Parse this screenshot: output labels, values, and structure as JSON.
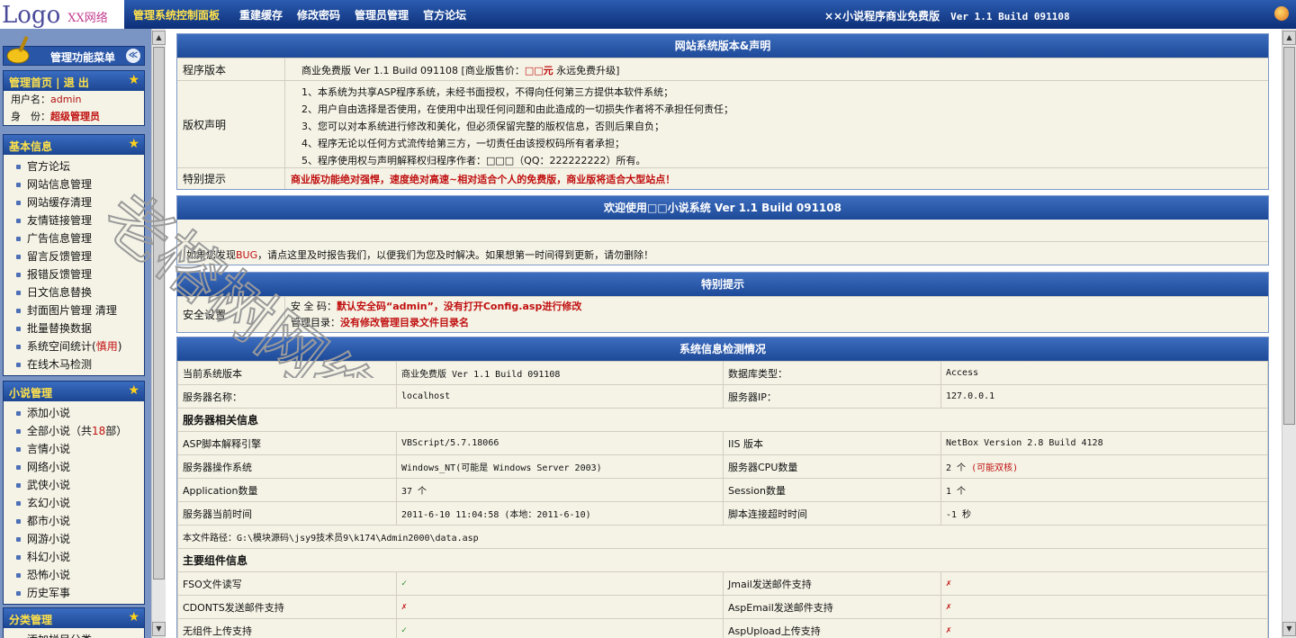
{
  "logo": {
    "main": "Logo",
    "sub": "XX网络"
  },
  "topnav": {
    "items": [
      "管理系统控制面板",
      "重建缓存",
      "修改密码",
      "管理员管理",
      "官方论坛"
    ],
    "right_title": "××小说程序商业免费版",
    "right_version": "Ver 1.1 Build 091108"
  },
  "sidebar": {
    "header": "管理功能菜单",
    "home_box": {
      "title": "管理首页 | 退 出",
      "user_label": "用户名：",
      "user_value": "admin",
      "role_label": "身　份：",
      "role_value": "超级管理员"
    },
    "basic": {
      "title": "基本信息",
      "items": [
        "官方论坛",
        "网站信息管理",
        "网站缓存清理",
        "友情链接管理",
        "广告信息管理",
        "留言反馈管理",
        "报错反馈管理",
        "日文信息替换",
        "封面图片管理 清理",
        "批量替换数据",
        "系统空间统计(",
        "在线木马检测"
      ],
      "items_extra": "慎用",
      "items_extra_close": ")"
    },
    "novel": {
      "title": "小说管理",
      "items": [
        "添加小说",
        "全部小说（共",
        "言情小说",
        "网络小说",
        "武侠小说",
        "玄幻小说",
        "都市小说",
        "网游小说",
        "科幻小说",
        "恐怖小说",
        "历史军事"
      ],
      "count": "18",
      "count_suffix": "部）"
    },
    "category": {
      "title": "分类管理",
      "items": [
        "添加栏目分类"
      ]
    }
  },
  "panel1": {
    "title": "网站系统版本&声明",
    "version_label": "程序版本",
    "version_prefix": "商业免费版  Ver 1.1 Build 091108 [商业版售价：",
    "version_price": "□□元",
    "version_suffix": " 永远免费升级]",
    "copyright_label": "版权声明",
    "copyright_lines": [
      "1、本系统为共享ASP程序系统，未经书面授权，不得向任何第三方提供本软件系统；",
      "2、用户自由选择是否使用，在使用中出现任何问题和由此造成的一切损失作者将不承担任何责任；",
      "3、您可以对本系统进行修改和美化，但必须保留完整的版权信息，否则后果自负；",
      "4、程序无论以任何方式流传给第三方，一切责任由该授权码所有者承担；",
      "5、程序使用权与声明解释权归程序作者：□□□（QQ：222222222）所有。"
    ],
    "tips_label": "特别提示",
    "tips_text": "商业版功能绝对强悍，速度绝对高速~相对适合个人的免费版，商业版将适合大型站点！"
  },
  "panel2": {
    "title": "欢迎使用□□小说系统  Ver 1.1 Build 091108",
    "text_before": "如果您发现",
    "bug": "BUG",
    "text_after": "，请点这里及时报告我们，以便我们为您及时解决。如果想第一时间得到更新，请勿删除！"
  },
  "panel3": {
    "title": "特别提示",
    "label": "安全设置",
    "code_label": "安 全 码：",
    "code_text": "默认安全码“admin”，没有打开Config.asp进行修改",
    "dir_label": "管理目录：",
    "dir_text": "没有修改管理目录文件目录名"
  },
  "panel4": {
    "title": "系统信息检测情况",
    "rows1": [
      [
        "当前系统版本",
        "商业免费版  Ver 1.1 Build 091108",
        "数据库类型：",
        "Access"
      ],
      [
        "服务器名称：",
        "localhost",
        "服务器IP：",
        "127.0.0.1"
      ]
    ],
    "section1": "服务器相关信息",
    "rows2": [
      [
        "ASP脚本解释引擎",
        "VBScript/5.7.18066",
        "IIS 版本",
        "NetBox Version 2.8 Build 4128"
      ],
      [
        "服务器操作系统",
        "Windows_NT(可能是 Windows Server 2003)",
        "服务器CPU数量",
        "2 个"
      ],
      [
        "Application数量",
        "37 个",
        "Session数量",
        "1 个"
      ],
      [
        "服务器当前时间",
        "2011-6-10 11:04:58  (本地：2011-6-10)",
        "脚本连接超时时间",
        "-1 秒"
      ]
    ],
    "cpu_note": "(可能双核)",
    "path": "本文件路径：G:\\模块源码\\jsy9技术员9\\k174\\Admin2000\\data.asp",
    "section2": "主要组件信息",
    "comp_rows": [
      [
        "FSO文件读写",
        "✓",
        "Jmail发送邮件支持",
        "✗"
      ],
      [
        "CDONTS发送邮件支持",
        "✗",
        "AspEmail发送邮件支持",
        "✗"
      ],
      [
        "无组件上传支持",
        "✓",
        "AspUpload上传支持",
        "✗"
      ]
    ]
  },
  "watermark": "老榕树网络",
  "colors": {
    "header_blue": "#2b5cb0",
    "accent_yellow": "#ffe24a",
    "alert_red": "#c01010",
    "panel_bg": "#f5f3e6"
  }
}
